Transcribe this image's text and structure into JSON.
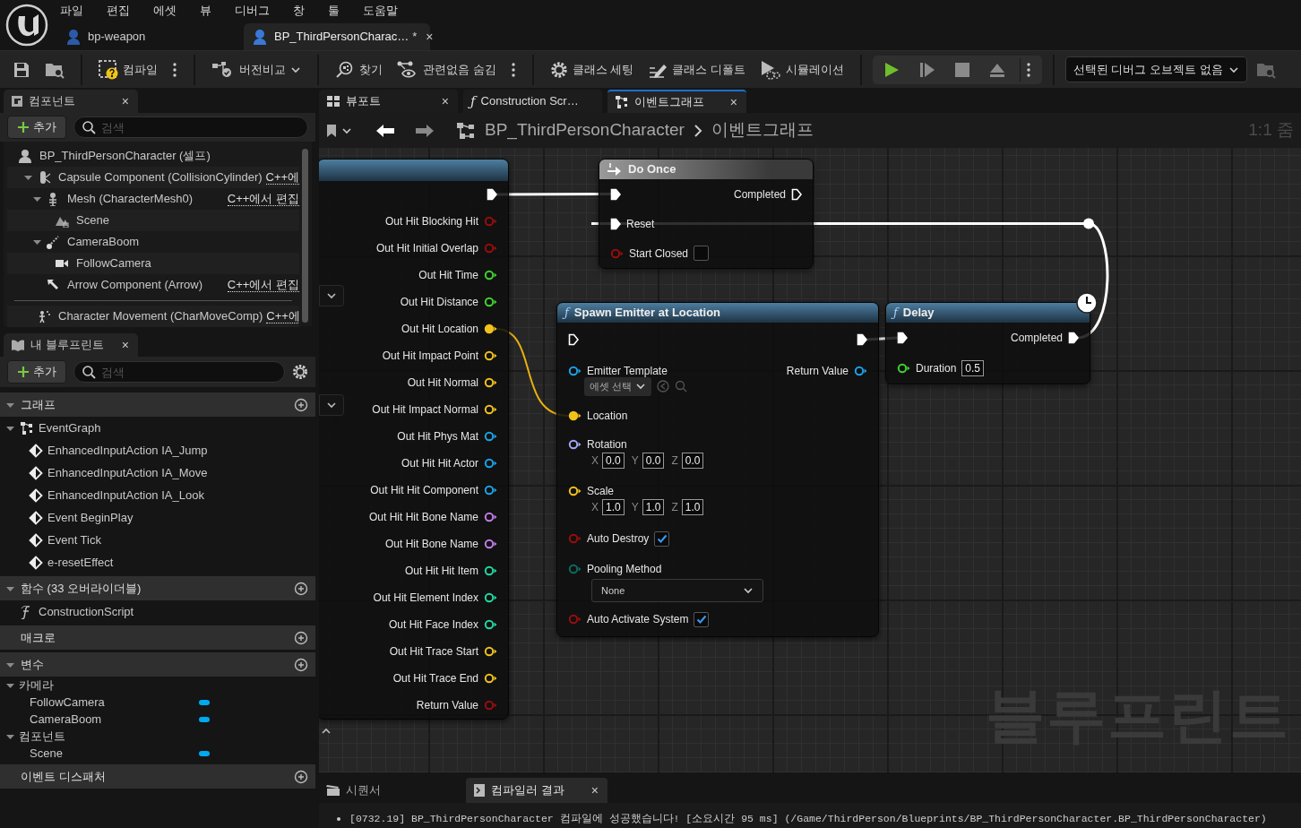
{
  "app_menu": [
    "파일",
    "편집",
    "에셋",
    "뷰",
    "디버그",
    "창",
    "툴",
    "도움말"
  ],
  "asset_tabs": [
    {
      "label": "bp-weapon",
      "selected": false
    },
    {
      "label": "BP_ThirdPersonCharac…",
      "modified": "*",
      "close": "×",
      "selected": true
    }
  ],
  "toolbar": {
    "compile": "컴파일",
    "diff": "버전비교",
    "find": "찾기",
    "hide_unrelated": "관련없음 숨김",
    "class_settings": "클래스 세팅",
    "class_defaults": "클래스 디폴트",
    "simulation": "시뮬레이션",
    "debug_object": "선택된 디버그 오브젝트 없음"
  },
  "components_panel": {
    "title": "컴포넌트",
    "close": "×",
    "add": "추가",
    "search_placeholder": "검색",
    "root": "BP_ThirdPersonCharacter (셀프)",
    "items": [
      {
        "kind": "capsule",
        "label": "Capsule Component (CollisionCylinder)",
        "edit_link": "C++에",
        "separated": false,
        "expanded": true,
        "children": [
          {
            "kind": "mesh",
            "label": "Mesh (CharacterMesh0)",
            "edit_link": "C++에서 편집",
            "expanded": true,
            "children": [
              {
                "kind": "scene",
                "label": "Scene"
              }
            ]
          },
          {
            "kind": "spring-arm",
            "label": "CameraBoom",
            "expanded": true,
            "children": [
              {
                "kind": "camera",
                "label": "FollowCamera"
              }
            ]
          },
          {
            "kind": "arrow",
            "label": "Arrow Component (Arrow)",
            "edit_link": "C++에서 편집"
          }
        ]
      },
      {
        "kind": "movement",
        "label": "Character Movement (CharMoveComp)",
        "edit_link": "C++에",
        "separated": true
      }
    ]
  },
  "my_blueprint": {
    "title": "내 블루프린트",
    "close": "×",
    "add": "추가",
    "search_placeholder": "검색",
    "sections": [
      {
        "title": "그래프",
        "expanded": true,
        "items": [
          {
            "kind": "graph",
            "label": "EventGraph",
            "expanded": true,
            "children": [
              {
                "kind": "event",
                "label": "EnhancedInputAction IA_Jump"
              },
              {
                "kind": "event",
                "label": "EnhancedInputAction IA_Move"
              },
              {
                "kind": "event",
                "label": "EnhancedInputAction IA_Look"
              },
              {
                "kind": "event",
                "label": "Event BeginPlay"
              },
              {
                "kind": "event",
                "label": "Event Tick"
              },
              {
                "kind": "event",
                "label": "e-resetEffect"
              }
            ]
          }
        ]
      },
      {
        "title": "함수 (33 오버라이더블)",
        "expanded": true,
        "items": [
          {
            "kind": "function",
            "label": "ConstructionScript"
          }
        ]
      },
      {
        "title": "매크로",
        "expanded": false
      },
      {
        "title": "변수",
        "expanded": true,
        "categories": [
          {
            "title": "카메라",
            "expanded": true,
            "items": [
              "FollowCamera",
              "CameraBoom"
            ]
          },
          {
            "title": "컴포넌트",
            "expanded": true,
            "items": [
              "Scene"
            ]
          }
        ]
      },
      {
        "title": "이벤트 디스패처",
        "expanded": false
      }
    ]
  },
  "graph_tabs": [
    {
      "kind": "viewport",
      "label": "뷰포트",
      "close": "×",
      "selected": false
    },
    {
      "kind": "function",
      "glyph": "ƒ",
      "label": "Construction Scr…",
      "selected": false
    },
    {
      "kind": "graph",
      "label": "이벤트그래프",
      "close": "×",
      "selected": true
    }
  ],
  "breadcrumb": [
    "BP_ThirdPersonCharacter",
    "이벤트그래프"
  ],
  "zoom": "1:1 줌",
  "watermark": "블루프린트",
  "nodes": [
    {
      "kind": "function",
      "latent": false,
      "rows": [
        {
          "right": {
            "kind": "exec",
            "connected": true
          }
        },
        {
          "right": {
            "kind": "data",
            "label": "Out Hit Blocking Hit",
            "color": "#9a0d0d",
            "connected": false
          }
        },
        {
          "right": {
            "kind": "data",
            "label": "Out Hit Initial Overlap",
            "color": "#9a0d0d",
            "connected": false
          }
        },
        {
          "right": {
            "kind": "data",
            "label": "Out Hit Time",
            "color": "#3fd32f",
            "connected": false
          }
        },
        {
          "right": {
            "kind": "data",
            "label": "Out Hit Distance",
            "color": "#3fd32f",
            "connected": false
          }
        },
        {
          "right": {
            "kind": "data",
            "label": "Out Hit Location",
            "color": "#f2c21b",
            "connected": true
          }
        },
        {
          "right": {
            "kind": "data",
            "label": "Out Hit Impact Point",
            "color": "#f2c21b",
            "connected": false
          }
        },
        {
          "right": {
            "kind": "data",
            "label": "Out Hit Normal",
            "color": "#f2c21b",
            "connected": false
          }
        },
        {
          "right": {
            "kind": "data",
            "label": "Out Hit Impact Normal",
            "color": "#f2c21b",
            "connected": false
          }
        },
        {
          "right": {
            "kind": "data",
            "label": "Out Hit Phys Mat",
            "color": "#1aa3e8",
            "connected": false
          }
        },
        {
          "right": {
            "kind": "data",
            "label": "Out Hit Hit Actor",
            "color": "#1aa3e8",
            "connected": false
          }
        },
        {
          "right": {
            "kind": "data",
            "label": "Out Hit Hit Component",
            "color": "#1aa3e8",
            "connected": false
          }
        },
        {
          "right": {
            "kind": "data",
            "label": "Out Hit Hit Bone Name",
            "color": "#c07ce8",
            "connected": false
          }
        },
        {
          "right": {
            "kind": "data",
            "label": "Out Hit Bone Name",
            "color": "#c07ce8",
            "connected": false
          }
        },
        {
          "right": {
            "kind": "data",
            "label": "Out Hit Hit Item",
            "color": "#22d8a2",
            "connected": false
          }
        },
        {
          "right": {
            "kind": "data",
            "label": "Out Hit Element Index",
            "color": "#22d8a2",
            "connected": false
          }
        },
        {
          "right": {
            "kind": "data",
            "label": "Out Hit Face Index",
            "color": "#22d8a2",
            "connected": false
          }
        },
        {
          "right": {
            "kind": "data",
            "label": "Out Hit Trace Start",
            "color": "#f2c21b",
            "connected": false
          }
        },
        {
          "right": {
            "kind": "data",
            "label": "Out Hit Trace End",
            "color": "#f2c21b",
            "connected": false
          }
        },
        {
          "right": {
            "kind": "data",
            "label": "Return Value",
            "color": "#9a0d0d",
            "connected": false
          }
        }
      ]
    },
    {
      "kind": "macro",
      "title": "Do Once",
      "latent": false,
      "rows": [
        {
          "left": {
            "kind": "exec",
            "connected": true
          },
          "right": {
            "kind": "exec",
            "label": "Completed",
            "connected": false
          }
        },
        {
          "left": {
            "kind": "exec",
            "label": "Reset",
            "connected": true
          }
        },
        {
          "left": {
            "kind": "data",
            "label": "Start Closed",
            "color": "#9a0d0d",
            "connected": false,
            "checked": false
          }
        }
      ]
    },
    {
      "kind": "function",
      "glyph": "ƒ",
      "title": "Spawn Emitter at Location",
      "latent": false,
      "rows": [
        {
          "left": {
            "kind": "exec",
            "connected": false
          },
          "right": {
            "kind": "exec",
            "connected": true
          }
        },
        {
          "left": {
            "kind": "data",
            "label": "Emitter Template",
            "color": "#1aa3e8",
            "connected": false,
            "asset": "에셋 선택"
          },
          "right": {
            "kind": "data",
            "label": "Return Value",
            "color": "#1aa3e8",
            "connected": false
          }
        },
        {
          "left": {
            "kind": "data",
            "label": "Location",
            "color": "#f2c21b",
            "connected": true
          }
        },
        {
          "left": {
            "kind": "data",
            "label": "Rotation",
            "color": "#a3a8f5",
            "connected": false,
            "vector": [
              {
                "axis": "X",
                "value": "0.0"
              },
              {
                "axis": "Y",
                "value": "0.0"
              },
              {
                "axis": "Z",
                "value": "0.0"
              }
            ]
          }
        },
        {
          "left": {
            "kind": "data",
            "label": "Scale",
            "color": "#f2c21b",
            "connected": false,
            "vector": [
              {
                "axis": "X",
                "value": "1.0"
              },
              {
                "axis": "Y",
                "value": "1.0"
              },
              {
                "axis": "Z",
                "value": "1.0"
              }
            ]
          }
        },
        {
          "left": {
            "kind": "data",
            "label": "Auto Destroy",
            "color": "#9a0d0d",
            "connected": false,
            "checked": true
          }
        },
        {
          "left": {
            "kind": "data",
            "label": "Pooling Method",
            "color": "#0b6b5c",
            "connected": false,
            "dropdown": "None"
          }
        },
        {
          "left": {
            "kind": "data",
            "label": "Auto Activate System",
            "color": "#9a0d0d",
            "connected": false,
            "checked": true
          }
        }
      ]
    },
    {
      "kind": "function",
      "glyph": "ƒ",
      "title": "Delay",
      "latent": true,
      "rows": [
        {
          "left": {
            "kind": "exec",
            "connected": true
          },
          "right": {
            "kind": "exec",
            "label": "Completed",
            "connected": true
          }
        },
        {
          "left": {
            "kind": "data",
            "label": "Duration",
            "color": "#3fd32f",
            "connected": false,
            "value": "0.5"
          }
        }
      ]
    }
  ],
  "bottom_tabs": [
    {
      "kind": "sequencer",
      "label": "시퀀서",
      "selected": false
    },
    {
      "kind": "compiler",
      "label": "컴파일러 결과",
      "close": "×",
      "selected": true
    }
  ],
  "log": [
    "[0732.19] BP_ThirdPersonCharacter 컴파일에 성공했습니다! [소요시간 95 ms] (/Game/ThirdPerson/Blueprints/BP_ThirdPersonCharacter.BP_ThirdPersonCharacter)"
  ]
}
